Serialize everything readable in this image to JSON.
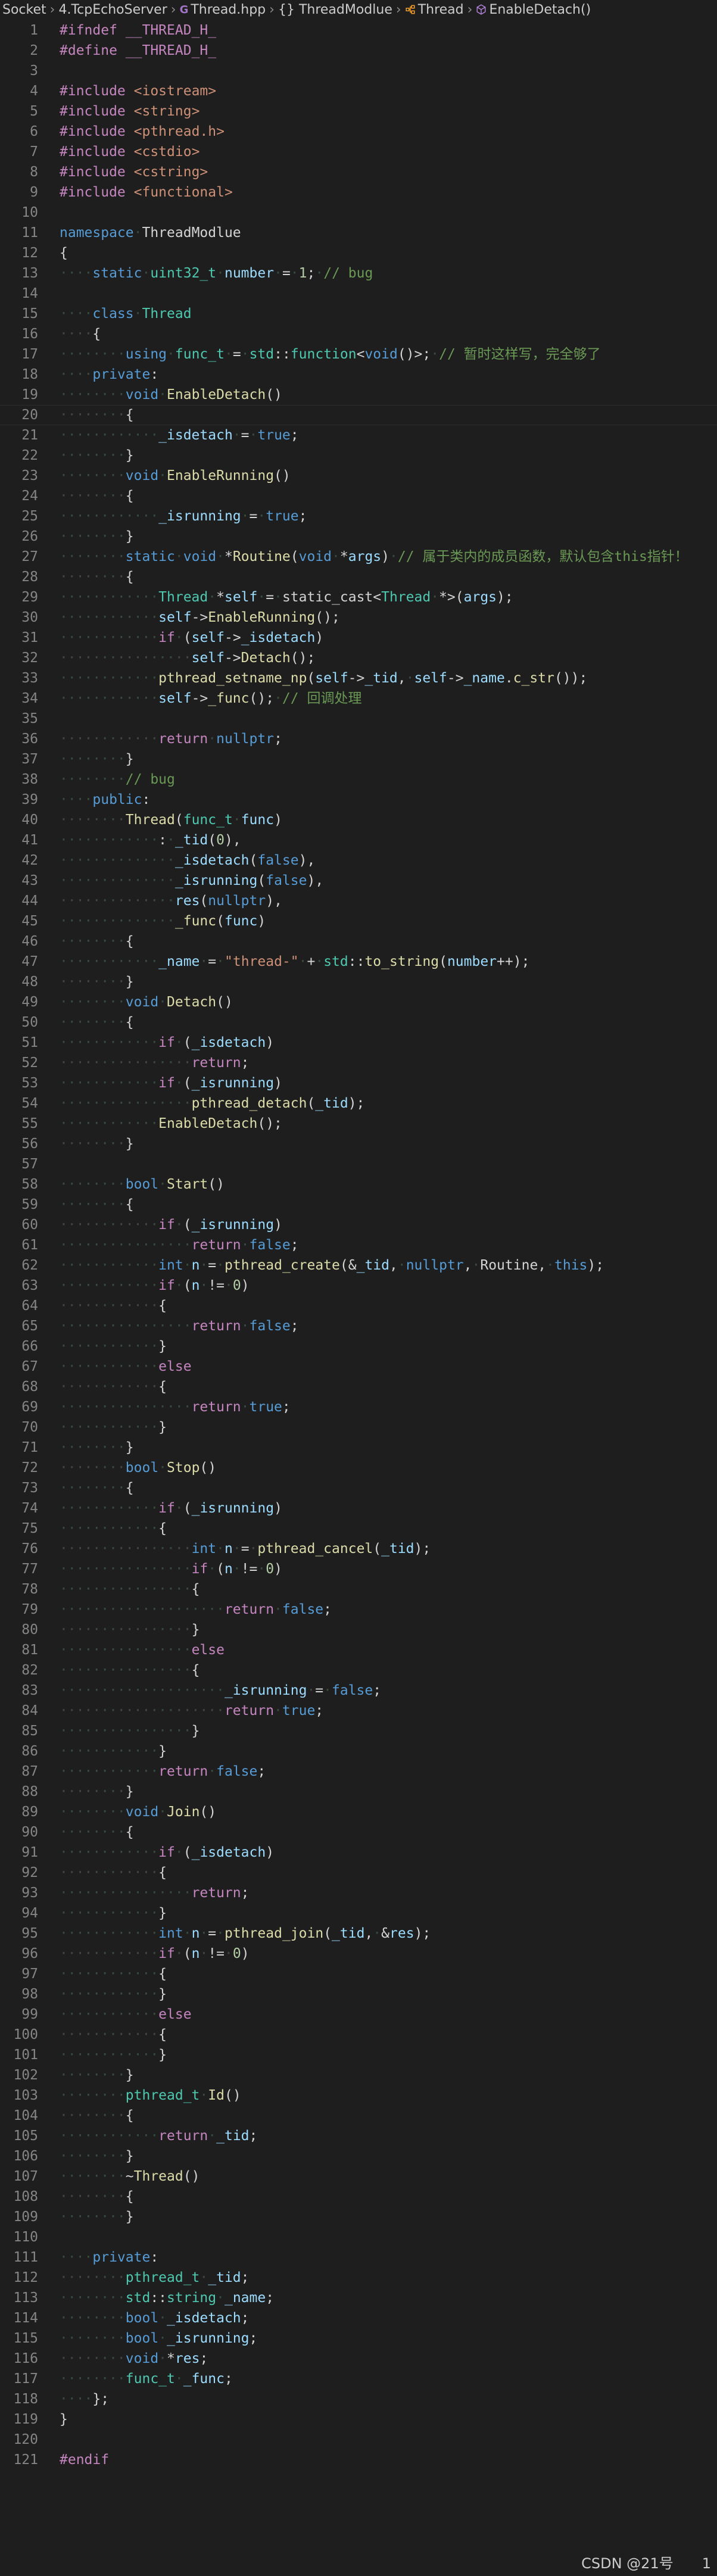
{
  "breadcrumb": {
    "items": [
      {
        "label": "Socket",
        "icon": "none"
      },
      {
        "label": "4.TcpEchoServer",
        "icon": "none"
      },
      {
        "label": "Thread.hpp",
        "icon": "cpp-file-icon"
      },
      {
        "label": "{} ThreadModlue",
        "icon": "namespace-icon"
      },
      {
        "label": "Thread",
        "icon": "class-icon"
      },
      {
        "label": "EnableDetach()",
        "icon": "method-icon"
      }
    ]
  },
  "editor": {
    "active_line": 20,
    "lines": [
      "#ifndef __THREAD_H_",
      "#define __THREAD_H_",
      "",
      "#include <iostream>",
      "#include <string>",
      "#include <pthread.h>",
      "#include <cstdio>",
      "#include <cstring>",
      "#include <functional>",
      "",
      "namespace ThreadModlue",
      "{",
      "    static uint32_t number = 1; // bug",
      "",
      "    class Thread",
      "    {",
      "        using func_t = std::function<void()>; // 暂时这样写，完全够了",
      "    private:",
      "        void EnableDetach()",
      "        {",
      "            _isdetach = true;",
      "        }",
      "        void EnableRunning()",
      "        {",
      "            _isrunning = true;",
      "        }",
      "        static void *Routine(void *args) // 属于类内的成员函数，默认包含this指针！",
      "        {",
      "            Thread *self = static_cast<Thread *>(args);",
      "            self->EnableRunning();",
      "            if (self->_isdetach)",
      "                self->Detach();",
      "            pthread_setname_np(self->_tid, self->_name.c_str());",
      "            self->_func(); // 回调处理",
      "",
      "            return nullptr;",
      "        }",
      "        // bug",
      "    public:",
      "        Thread(func_t func)",
      "            : _tid(0),",
      "              _isdetach(false),",
      "              _isrunning(false),",
      "              res(nullptr),",
      "              _func(func)",
      "        {",
      "            _name = \"thread-\" + std::to_string(number++);",
      "        }",
      "        void Detach()",
      "        {",
      "            if (_isdetach)",
      "                return;",
      "            if (_isrunning)",
      "                pthread_detach(_tid);",
      "            EnableDetach();",
      "        }",
      "",
      "        bool Start()",
      "        {",
      "            if (_isrunning)",
      "                return false;",
      "            int n = pthread_create(&_tid, nullptr, Routine, this);",
      "            if (n != 0)",
      "            {",
      "                return false;",
      "            }",
      "            else",
      "            {",
      "                return true;",
      "            }",
      "        }",
      "        bool Stop()",
      "        {",
      "            if (_isrunning)",
      "            {",
      "                int n = pthread_cancel(_tid);",
      "                if (n != 0)",
      "                {",
      "                    return false;",
      "                }",
      "                else",
      "                {",
      "                    _isrunning = false;",
      "                    return true;",
      "                }",
      "            }",
      "            return false;",
      "        }",
      "        void Join()",
      "        {",
      "            if (_isdetach)",
      "            {",
      "                return;",
      "            }",
      "            int n = pthread_join(_tid, &res);",
      "            if (n != 0)",
      "            {",
      "            }",
      "            else",
      "            {",
      "            }",
      "        }",
      "        pthread_t Id()",
      "        {",
      "            return _tid;",
      "        }",
      "        ~Thread()",
      "        {",
      "        }",
      "",
      "    private:",
      "        pthread_t _tid;",
      "        std::string _name;",
      "        bool _isdetach;",
      "        bool _isrunning;",
      "        void *res;",
      "        func_t _func;",
      "    };",
      "}",
      "",
      "#endif"
    ]
  },
  "watermark": "CSDN @21号　　1"
}
